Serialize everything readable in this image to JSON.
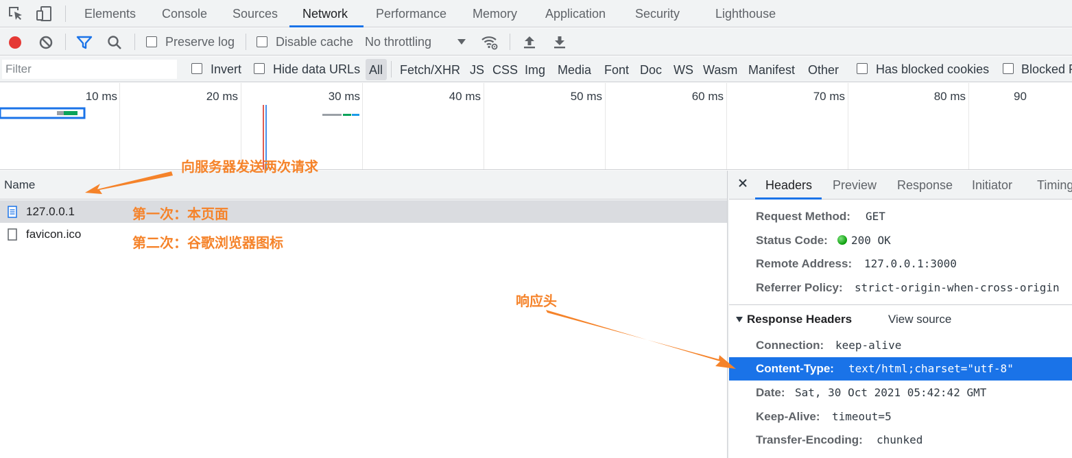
{
  "colors": {
    "accent": "#1a73e8",
    "record": "#e53935",
    "annotation": "#f5832a",
    "highlight": "#1a73e8"
  },
  "main_tabs": [
    {
      "label": "Elements"
    },
    {
      "label": "Console"
    },
    {
      "label": "Sources"
    },
    {
      "label": "Network"
    },
    {
      "label": "Performance"
    },
    {
      "label": "Memory"
    },
    {
      "label": "Application"
    },
    {
      "label": "Security"
    },
    {
      "label": "Lighthouse"
    }
  ],
  "toolbar": {
    "preserve_log": "Preserve log",
    "disable_cache": "Disable cache",
    "throttling": "No throttling"
  },
  "filter": {
    "placeholder": "Filter",
    "invert": "Invert",
    "hide_data_urls": "Hide data URLs",
    "types": [
      "All",
      "Fetch/XHR",
      "JS",
      "CSS",
      "Img",
      "Media",
      "Font",
      "Doc",
      "WS",
      "Wasm",
      "Manifest",
      "Other"
    ],
    "has_blocked_cookies": "Has blocked cookies",
    "blocked": "Blocked R"
  },
  "overview": {
    "ticks": [
      "10 ms",
      "20 ms",
      "30 ms",
      "40 ms",
      "50 ms",
      "60 ms",
      "70 ms",
      "80 ms",
      "90"
    ]
  },
  "name_panel": {
    "header": "Name",
    "rows": [
      {
        "name": "127.0.0.1"
      },
      {
        "name": "favicon.ico"
      }
    ]
  },
  "details": {
    "tabs": [
      {
        "label": "Headers"
      },
      {
        "label": "Preview"
      },
      {
        "label": "Response"
      },
      {
        "label": "Initiator"
      },
      {
        "label": "Timing"
      }
    ],
    "general": [
      {
        "key": "Request Method:",
        "value": "GET"
      },
      {
        "key": "Status Code:",
        "value": "200  OK"
      },
      {
        "key": "Remote Address:",
        "value": "127.0.0.1:3000"
      },
      {
        "key": "Referrer Policy:",
        "value": "strict-origin-when-cross-origin"
      }
    ],
    "response_headers_title": "Response Headers",
    "view_source": "View source",
    "response_headers": [
      {
        "key": "Connection:",
        "value": "keep-alive"
      },
      {
        "key": "Content-Type:",
        "value": "text/html;charset=\"utf-8\""
      },
      {
        "key": "Date:",
        "value": "Sat, 30 Oct 2021 05:42:42 GMT"
      },
      {
        "key": "Keep-Alive:",
        "value": "timeout=5"
      },
      {
        "key": "Transfer-Encoding:",
        "value": "chunked"
      }
    ]
  },
  "annotations": {
    "two_requests": "向服务器发送两次请求",
    "first": "第一次：本页面",
    "second": "第二次：谷歌浏览器图标",
    "response_header": "响应头"
  }
}
